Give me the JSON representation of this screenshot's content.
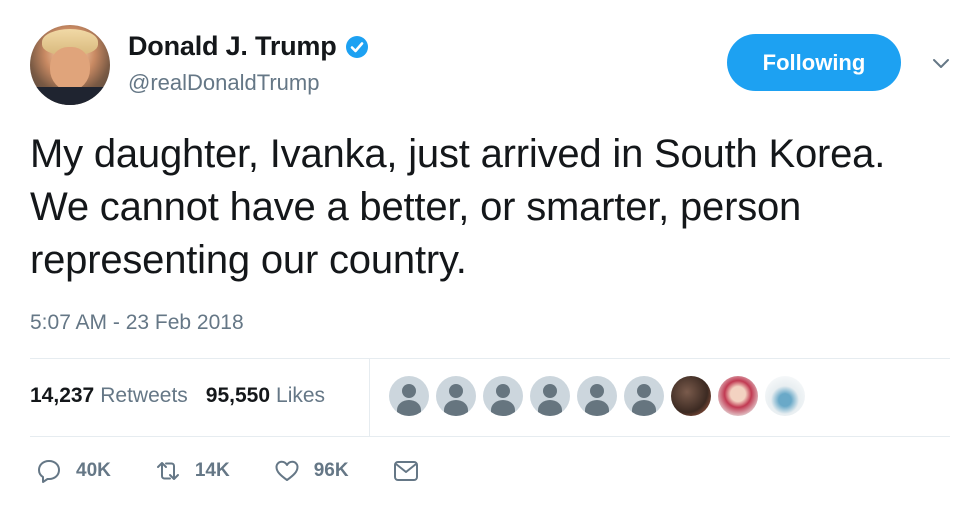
{
  "user": {
    "display_name": "Donald J. Trump",
    "handle": "@realDonaldTrump",
    "verified": true,
    "avatar_icon": "profile-photo"
  },
  "follow_button": {
    "label": "Following"
  },
  "tweet": {
    "text": "My daughter, Ivanka, just arrived in South Korea. We cannot have a better, or smarter, person representing our country.",
    "timestamp": "5:07 AM - 23 Feb 2018"
  },
  "stats": {
    "retweets_count": "14,237",
    "retweets_label": "Retweets",
    "likes_count": "95,550",
    "likes_label": "Likes"
  },
  "liker_avatars": [
    "default",
    "default",
    "default",
    "default",
    "default",
    "default",
    "photo",
    "photo",
    "photo"
  ],
  "actions": {
    "reply_count": "40K",
    "retweet_count": "14K",
    "like_count": "96K"
  },
  "colors": {
    "accent": "#1da1f2",
    "text_primary": "#14171a",
    "text_secondary": "#657786",
    "divider": "#e6ecf0"
  }
}
